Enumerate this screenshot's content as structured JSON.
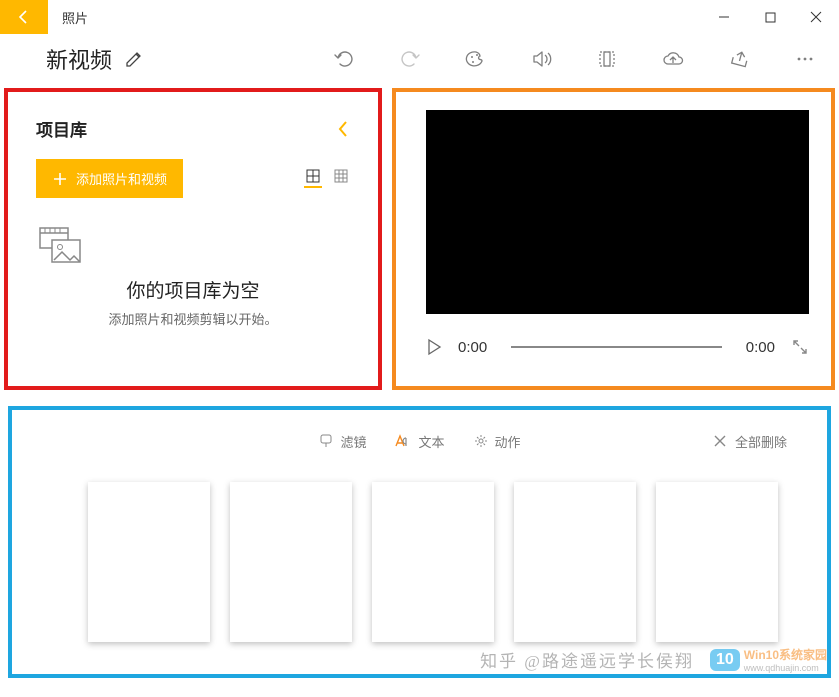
{
  "window": {
    "app_title": "照片"
  },
  "toolbar": {
    "project_title": "新视频",
    "icons": {
      "edit": "pencil-icon",
      "undo": "undo-icon",
      "redo": "redo-icon",
      "palette": "palette-icon",
      "sound": "speaker-icon",
      "aspect": "aspect-ratio-icon",
      "cloud": "cloud-upload-icon",
      "share": "share-icon",
      "more": "more-icon"
    }
  },
  "library": {
    "title": "项目库",
    "add_label": "添加照片和视频",
    "empty_title": "你的项目库为空",
    "empty_subtitle": "添加照片和视频剪辑以开始。"
  },
  "preview": {
    "current_time": "0:00",
    "total_time": "0:00"
  },
  "storyboard": {
    "filters_label": "滤镜",
    "text_label": "文本",
    "motion_label": "动作",
    "delete_all_label": "全部删除",
    "clip_count": 5
  },
  "watermarks": {
    "zhihu_text": "知乎 @路途遥远学长侯翔",
    "brand_logo_text": "10",
    "brand_line1": "Win10系统家园",
    "brand_line2": "www.qdhuajin.com"
  },
  "annotation_colors": {
    "library_box": "#e21b1b",
    "preview_box": "#f58a1f",
    "storyboard_box": "#1ea6e0"
  },
  "accent": "#ffb800"
}
